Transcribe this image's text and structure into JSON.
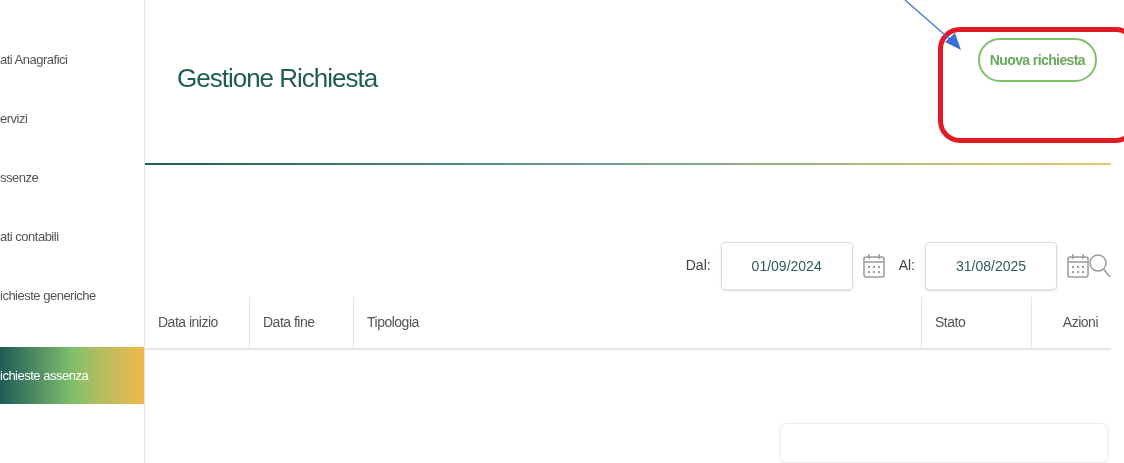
{
  "sidebar": {
    "items": [
      {
        "label": "ati Anagrafici",
        "selected": false
      },
      {
        "label": "ervizi",
        "selected": false
      },
      {
        "label": "ssenze",
        "selected": false
      },
      {
        "label": "ati contabili",
        "selected": false
      },
      {
        "label": "ichieste generiche",
        "selected": false
      },
      {
        "label": "ichieste assenza",
        "selected": true
      }
    ]
  },
  "header": {
    "title": "Gestione Richiesta",
    "button": "Nuova richiesta"
  },
  "filters": [
    {
      "label": "Dal:",
      "value": "01/09/2024"
    },
    {
      "label": "Al:",
      "value": "31/08/2025"
    }
  ],
  "table": {
    "columns": [
      "Data inizio",
      "Data fine",
      "Tipologia",
      "Stato",
      "Azioni"
    ]
  }
}
